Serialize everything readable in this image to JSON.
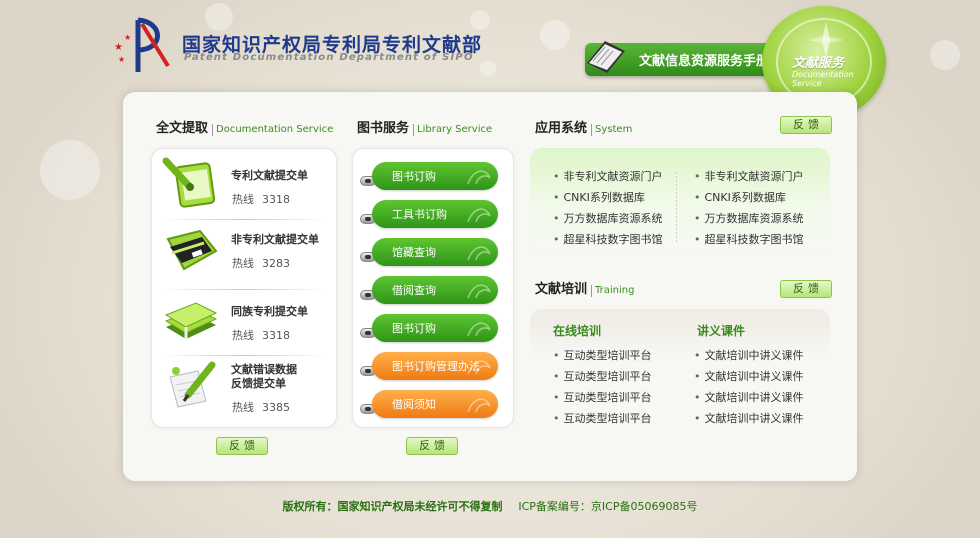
{
  "header": {
    "title": "国家知识产权局专利局专利文献部",
    "subtitle": "Patent Documentation Department of SIPO",
    "manual_button": "文献信息资源服务手册",
    "badge_title": "文献服务",
    "badge_subtitle": "Documentation Service"
  },
  "sections": {
    "fulltext": {
      "zh": "全文提取",
      "en": "Documentation Service"
    },
    "library": {
      "zh": "图书服务",
      "en": "Library Service"
    },
    "apps": {
      "zh": "应用系统",
      "en": "System"
    },
    "training": {
      "zh": "文献培训",
      "en": "Training"
    }
  },
  "fulltext_items": [
    {
      "name": "专利文献提交单",
      "hotline_label": "热线",
      "hotline": "3318",
      "icon": "notepad-pen-icon"
    },
    {
      "name": "非专利文献提交单",
      "hotline_label": "热线",
      "hotline": "3283",
      "icon": "folder-icon"
    },
    {
      "name": "同族专利提交单",
      "hotline_label": "热线",
      "hotline": "3318",
      "icon": "stacked-books-icon"
    },
    {
      "name_line1": "文献错误数据",
      "name_line2": "反馈提交单",
      "hotline_label": "热线",
      "hotline": "3385",
      "icon": "paper-pen-icon"
    }
  ],
  "library_buttons": [
    {
      "label": "图书订购",
      "color": "green"
    },
    {
      "label": "工具书订购",
      "color": "green"
    },
    {
      "label": "馆藏查询",
      "color": "green"
    },
    {
      "label": "借阅查询",
      "color": "green"
    },
    {
      "label": "图书订购",
      "color": "green"
    },
    {
      "label": "图书订购管理办法",
      "color": "orange"
    },
    {
      "label": "借阅须知",
      "color": "orange"
    }
  ],
  "feedback_label": "反馈",
  "apps_left": [
    "非专利文献资源门户",
    "CNKI系列数据库",
    "万方数据库资源系统",
    "超星科技数字图书馆"
  ],
  "apps_right": [
    "非专利文献资源门户",
    "CNKI系列数据库",
    "万方数据库资源系统",
    "超星科技数字图书馆"
  ],
  "training": {
    "online_title": "在线培训",
    "courseware_title": "讲义课件",
    "online": [
      "互动类型培训平台",
      "互动类型培训平台",
      "互动类型培训平台",
      "互动类型培训平台"
    ],
    "courseware": [
      "文献培训中讲义课件",
      "文献培训中讲义课件",
      "文献培训中讲义课件",
      "文献培训中讲义课件"
    ]
  },
  "footer": {
    "copyright": "版权所有：国家知识产权局未经许可不得复制",
    "icp": "ICP备案编号：京ICP备05069085号"
  },
  "colors": {
    "brand_green": "#3d8c22",
    "accent_orange": "#f07a12",
    "title_blue": "#1f3a8a"
  }
}
